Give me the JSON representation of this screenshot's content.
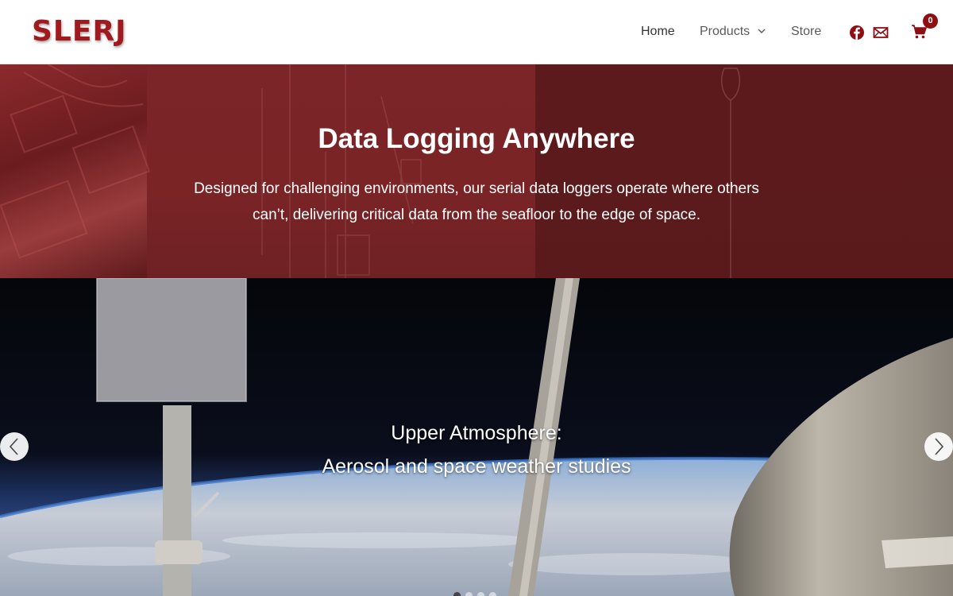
{
  "header": {
    "logo": "SLERJ",
    "nav": {
      "home": "Home",
      "products": "Products",
      "store": "Store"
    },
    "icons": [
      "facebook-icon",
      "mail-icon",
      "cart-icon"
    ],
    "cart_count": "0"
  },
  "hero": {
    "title": "Data Logging Anywhere",
    "text": "Designed for challenging environments, our serial data loggers operate where others can’t, delivering critical data from the seafloor to the edge of space."
  },
  "slider": {
    "line1": "Upper Atmosphere:",
    "line2": "Aerosol and space weather studies",
    "slide_count": 4,
    "active_slide": 1
  },
  "colors": {
    "brand": "#a11a1e",
    "hero_overlay": "#7a1f22",
    "cart_badge": "#8d0f14"
  }
}
